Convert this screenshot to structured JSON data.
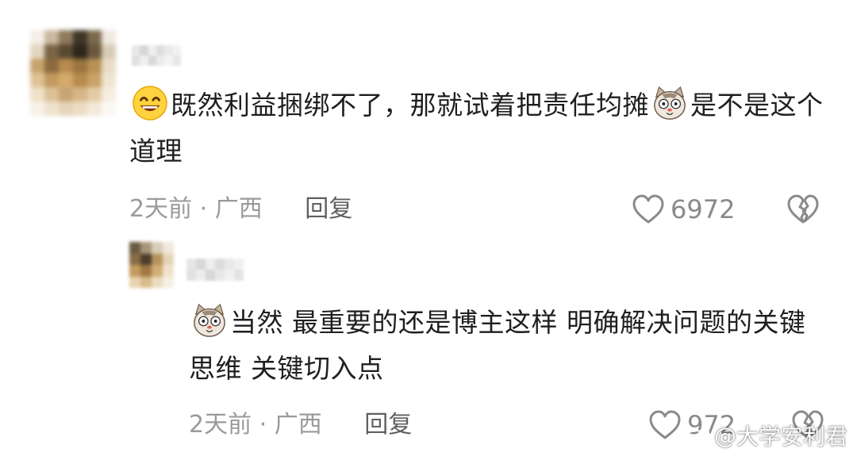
{
  "comments": [
    {
      "text_before_emoji": "既然利益捆绑不了，那就试着把责任均摊",
      "text_after_emoji": "是不是这个道理",
      "leading_emoji": "grinning-emoji",
      "inline_emoji": "cat-face-emoji",
      "time": "2天前",
      "separator": "·",
      "location": "广西",
      "reply_label": "回复",
      "likes": "6972"
    },
    {
      "leading_emoji": "cat-face-emoji",
      "text": "当然 最重要的还是博主这样 明确解决问题的关键思维 关键切入点",
      "time": "2天前",
      "separator": "·",
      "location": "广西",
      "reply_label": "回复",
      "likes": "972"
    }
  ],
  "watermark": {
    "at": "@",
    "handle": "大学安利君"
  },
  "colors": {
    "text": "#1f1f1f",
    "meta": "#9a9a9a",
    "icon": "#8a8a8a"
  }
}
